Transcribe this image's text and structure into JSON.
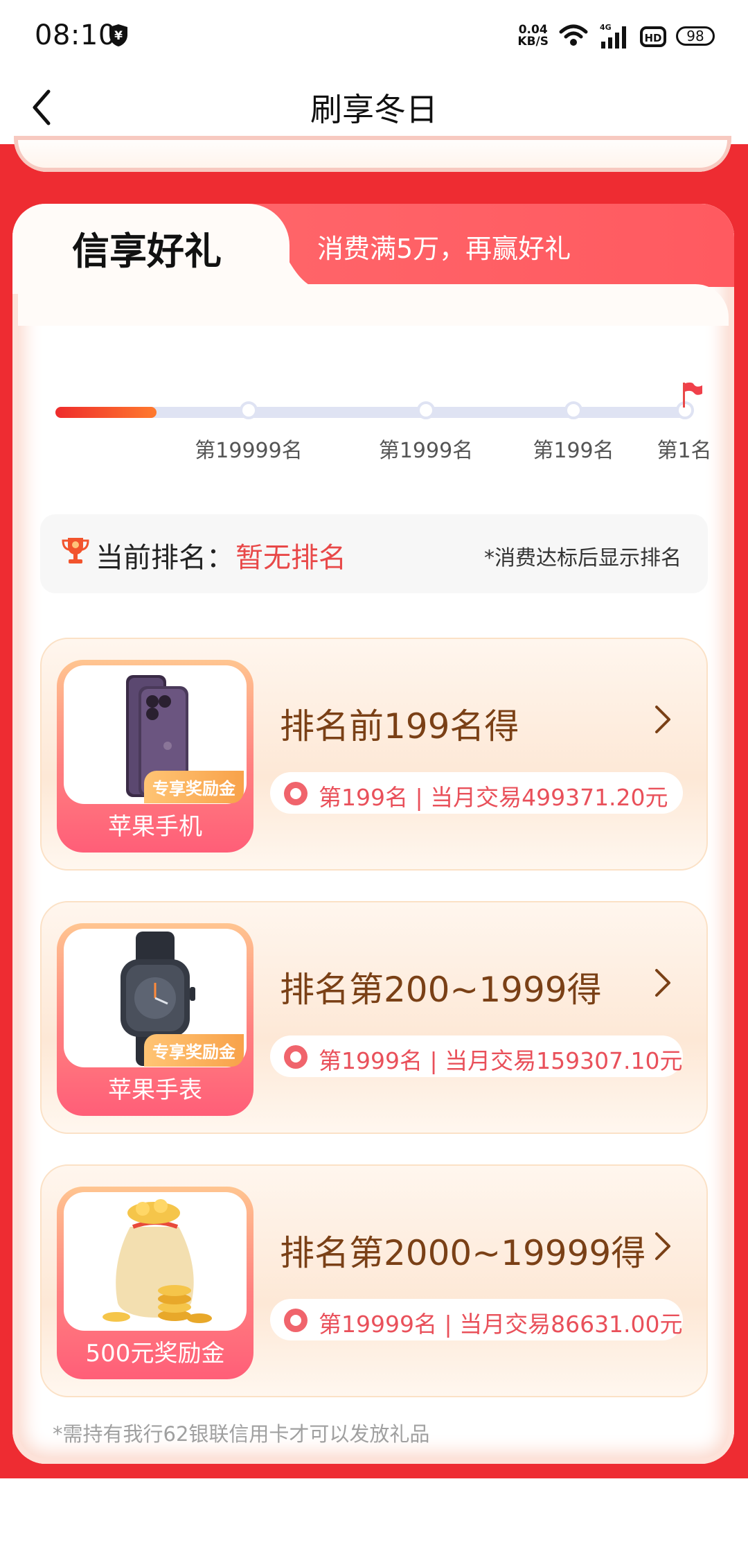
{
  "status_bar": {
    "time": "08:10",
    "net_speed_top": "0.04",
    "net_speed_bottom": "KB/S",
    "signal_type": "4G",
    "hd": "HD",
    "battery": "98"
  },
  "nav": {
    "title": "刷享冬日",
    "back_icon": "chevron-left-icon"
  },
  "tabs": {
    "active": "信享好礼",
    "inactive": "消费满5万，再赢好礼"
  },
  "progress": {
    "fraction": 0.16,
    "milestones": [
      "第19999名",
      "第1999名",
      "第199名",
      "第1名"
    ],
    "end_icon": "flag-icon"
  },
  "rank": {
    "label": "当前排名：",
    "value": "暂无排名",
    "note": "*消费达标后显示排名",
    "icon": "trophy-icon"
  },
  "rewards": [
    {
      "thumb_label": "苹果手机",
      "badge": "专享奖励金",
      "title": "排名前199名得",
      "info": "第199名 | 当月交易499371.20元"
    },
    {
      "thumb_label": "苹果手表",
      "badge": "专享奖励金",
      "title": "排名第200~1999得",
      "info": "第1999名 | 当月交易159307.10元"
    },
    {
      "thumb_label": "500元奖励金",
      "title": "排名第2000~19999得",
      "info": "第19999名 | 当月交易86631.00元"
    }
  ],
  "footnote": "*需持有我行62银联信用卡才可以发放礼品",
  "colors": {
    "red_background": "#ee2c32",
    "accent_red": "#e84848",
    "reward_title_brown": "#7a4016"
  }
}
